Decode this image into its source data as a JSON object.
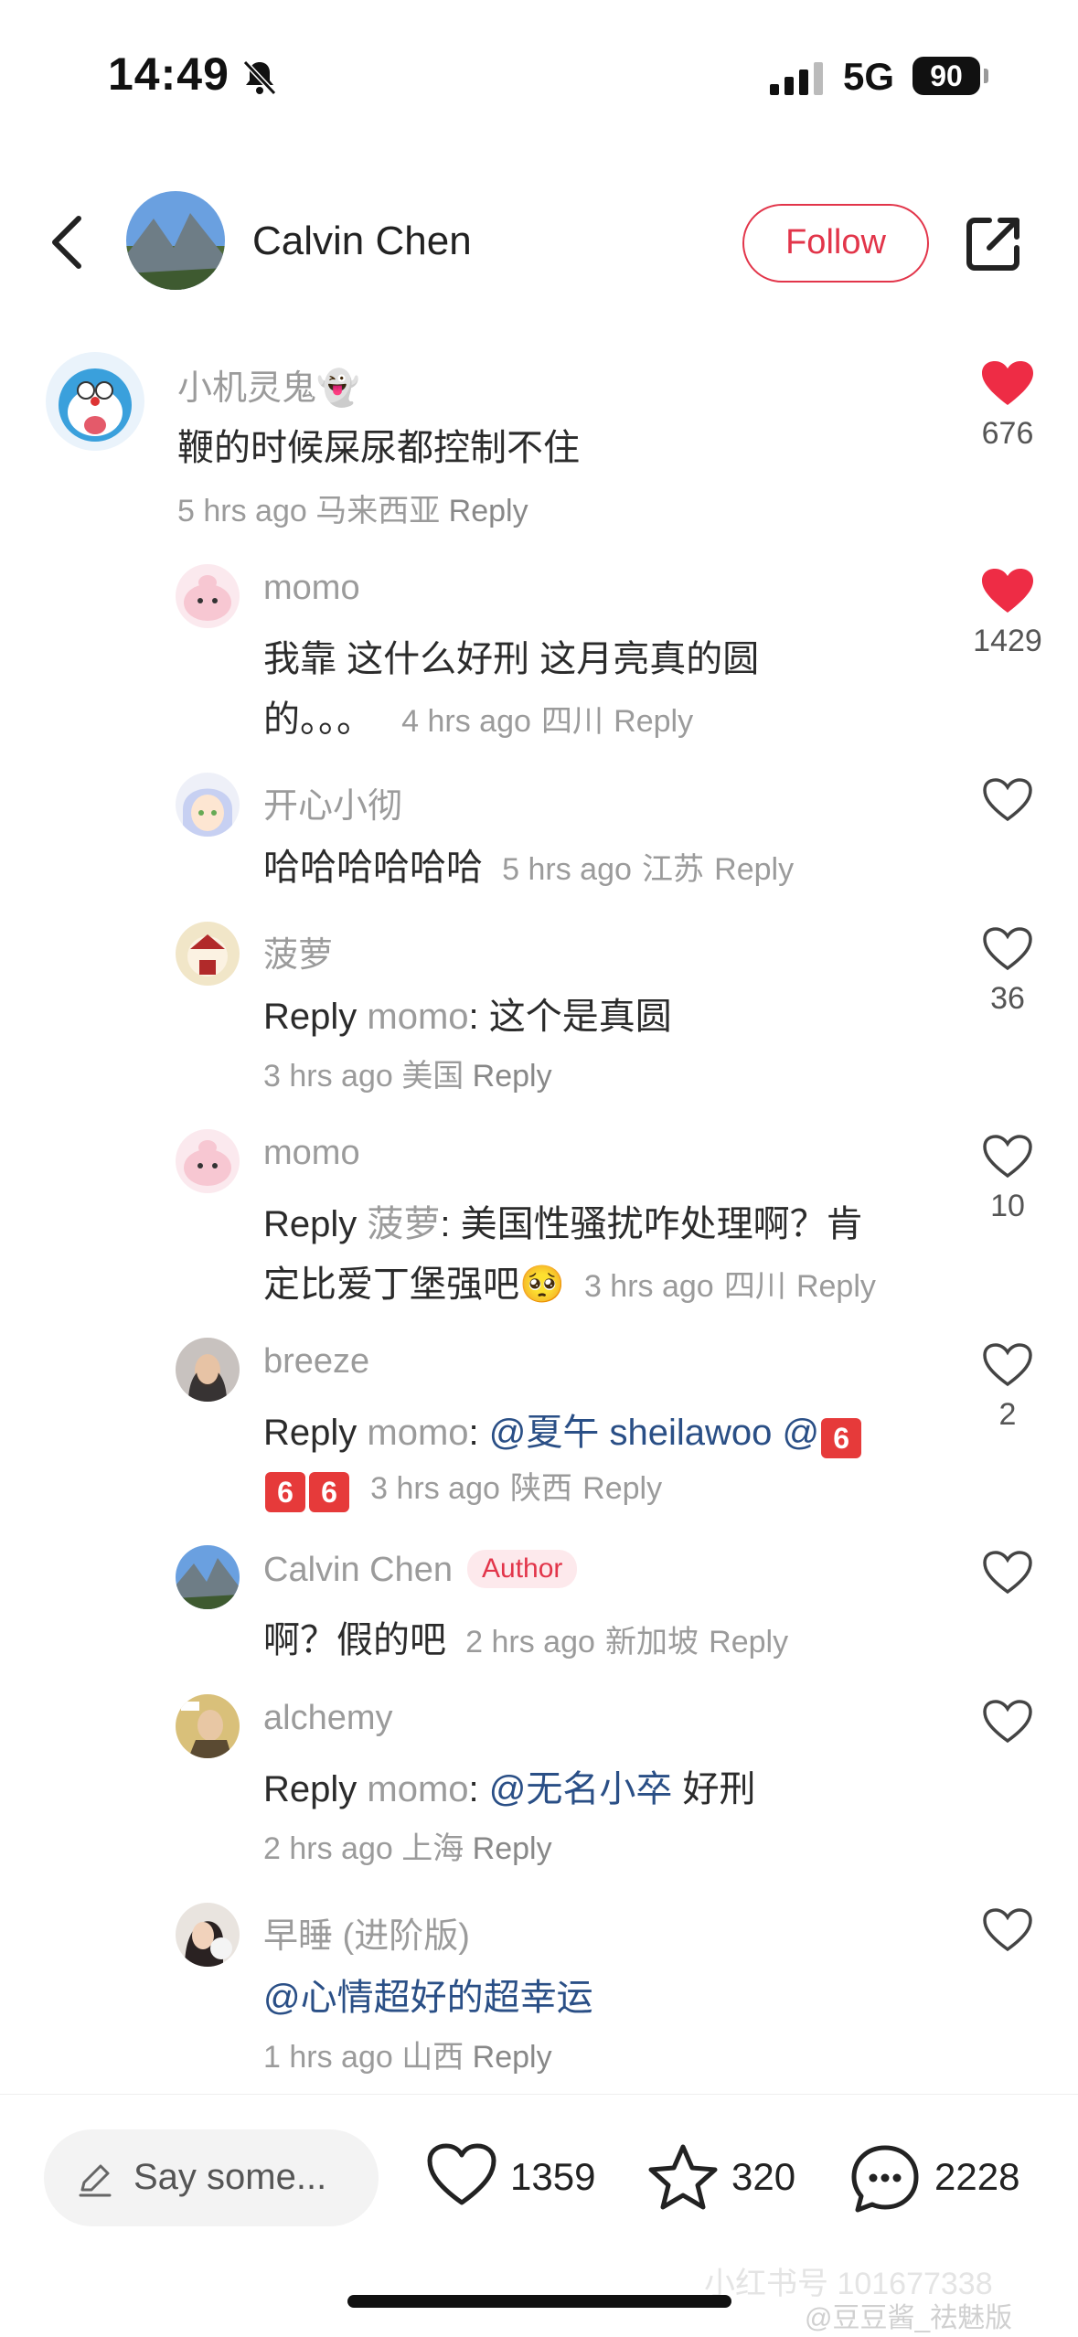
{
  "status_bar": {
    "time": "14:49",
    "network": "5G",
    "battery": "90"
  },
  "header": {
    "name": "Calvin Chen",
    "follow_label": "Follow"
  },
  "comments": [
    {
      "name": "小机灵鬼👻",
      "lines": [
        "鞭的时候屎尿都控制不住"
      ],
      "time": "5 hrs ago",
      "location": "马来西亚",
      "reply": "Reply",
      "likes": "676",
      "liked": true
    },
    {
      "name": "momo",
      "line1": "我靠 这什么好刑 这月亮真的圆",
      "line2": "的。。。",
      "time": "4 hrs ago",
      "location": "四川",
      "reply": "Reply",
      "likes": "1429",
      "liked": true
    },
    {
      "name": "开心小彻",
      "line1": "哈哈哈哈哈哈",
      "time": "5 hrs ago",
      "location": "江苏",
      "reply": "Reply",
      "likes": ""
    },
    {
      "name": "菠萝",
      "reply_prefix": "Reply",
      "reply_to": "momo",
      "text": ": 这个是真圆",
      "time": "3 hrs ago",
      "location": "美国",
      "reply": "Reply",
      "likes": "36"
    },
    {
      "name": "momo",
      "reply_prefix": "Reply",
      "reply_to": "菠萝",
      "text": ": 美国性骚扰咋处理啊？肯",
      "line2": "定比爱丁堡强吧🥺",
      "time": "3 hrs ago",
      "location": "四川",
      "reply": "Reply",
      "likes": "10"
    },
    {
      "name": "breeze",
      "reply_prefix": "Reply",
      "reply_to": "momo",
      "colon": ":",
      "mention": "@夏午 sheilawoo @",
      "emoji": "6",
      "time": "3 hrs ago",
      "location": "陕西",
      "reply": "Reply",
      "likes": "2"
    },
    {
      "name": "Calvin Chen",
      "badge": "Author",
      "line1": "啊？假的吧",
      "time": "2 hrs ago",
      "location": "新加坡",
      "reply": "Reply",
      "likes": ""
    },
    {
      "name": "alchemy",
      "reply_prefix": "Reply",
      "reply_to": "momo",
      "colon": ":",
      "mention": "@无名小卒",
      "text": "好刑",
      "time": "2 hrs ago",
      "location": "上海",
      "reply": "Reply",
      "likes": ""
    },
    {
      "name": "早睡 (进阶版)",
      "mention": "@心情超好的超幸运",
      "time": "1 hrs ago",
      "location": "山西",
      "reply": "Reply",
      "likes": ""
    }
  ],
  "bottom_bar": {
    "input_placeholder": "Say some...",
    "likes": "1359",
    "stars": "320",
    "comments": "2228"
  },
  "watermark": {
    "line1": "小红书号 101677338",
    "line2": "@豆豆酱_祛魅版"
  },
  "colors": {
    "accent": "#e2354a",
    "mention": "#2a4f86",
    "muted": "#9b9b9b"
  }
}
